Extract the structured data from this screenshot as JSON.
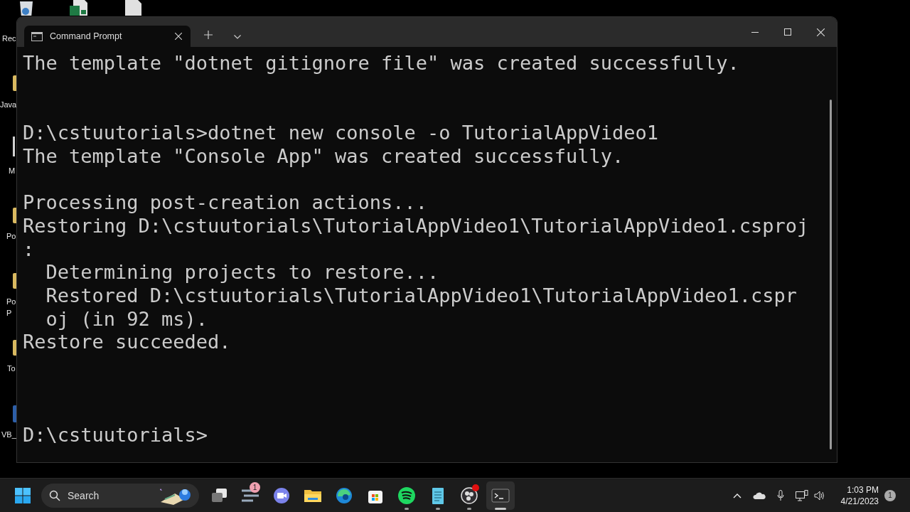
{
  "desktop": {
    "icons": [
      {
        "kind": "recycle",
        "labels": [
          "Rec"
        ]
      },
      {
        "kind": "excel"
      },
      {
        "kind": "file"
      },
      {
        "kind": "folder",
        "labels": [
          "Java"
        ]
      },
      {
        "kind": "app",
        "labels": [
          "M"
        ]
      },
      {
        "kind": "folder",
        "labels": [
          "Po"
        ]
      },
      {
        "kind": "folder",
        "labels": [
          "Po",
          "P"
        ]
      },
      {
        "kind": "folder",
        "labels": [
          "To"
        ]
      },
      {
        "kind": "vb",
        "labels": [
          "VB_"
        ]
      }
    ]
  },
  "window": {
    "tabs": [
      {
        "title": "Command Prompt",
        "selected": true
      }
    ],
    "lines": [
      {
        "kind": "text",
        "text": "The template \"dotnet gitignore file\" was created successfully."
      },
      {
        "kind": "blank"
      },
      {
        "kind": "blank"
      },
      {
        "kind": "text",
        "text": "D:\\cstuutorials>dotnet new console -o TutorialAppVideo1"
      },
      {
        "kind": "text",
        "text": "The template \"Console App\" was created successfully."
      },
      {
        "kind": "blank"
      },
      {
        "kind": "text",
        "text": "Processing post-creation actions..."
      },
      {
        "kind": "text",
        "text": "Restoring D:\\cstuutorials\\TutorialAppVideo1\\TutorialAppVideo1.csproj"
      },
      {
        "kind": "text",
        "text": ":"
      },
      {
        "kind": "text",
        "text": "  Determining projects to restore..."
      },
      {
        "kind": "text",
        "text": "  Restored D:\\cstuutorials\\TutorialAppVideo1\\TutorialAppVideo1.cspr"
      },
      {
        "kind": "text",
        "text": "  oj (in 92 ms)."
      },
      {
        "kind": "text",
        "text": "Restore succeeded."
      },
      {
        "kind": "blank"
      },
      {
        "kind": "blank"
      },
      {
        "kind": "blank"
      },
      {
        "kind": "text",
        "text": "D:\\cstuutorials>"
      }
    ]
  },
  "taskbar": {
    "search": {
      "placeholder": "Search"
    },
    "apps": [
      {
        "kind": "taskview",
        "running": false,
        "selected": false
      },
      {
        "kind": "widgets",
        "running": false,
        "selected": false,
        "badge": "1"
      },
      {
        "kind": "teams",
        "running": false,
        "selected": false
      },
      {
        "kind": "explorer",
        "running": false,
        "selected": false
      },
      {
        "kind": "edge",
        "running": false,
        "selected": false
      },
      {
        "kind": "store",
        "running": false,
        "selected": false
      },
      {
        "kind": "spotify",
        "running": true,
        "selected": false
      },
      {
        "kind": "notepad",
        "running": true,
        "selected": false
      },
      {
        "kind": "obs",
        "running": true,
        "selected": false,
        "alert": true
      },
      {
        "kind": "terminal",
        "running": true,
        "selected": true
      }
    ],
    "time": "1:03 PM",
    "date": "4/21/2023",
    "notifications": "1"
  }
}
